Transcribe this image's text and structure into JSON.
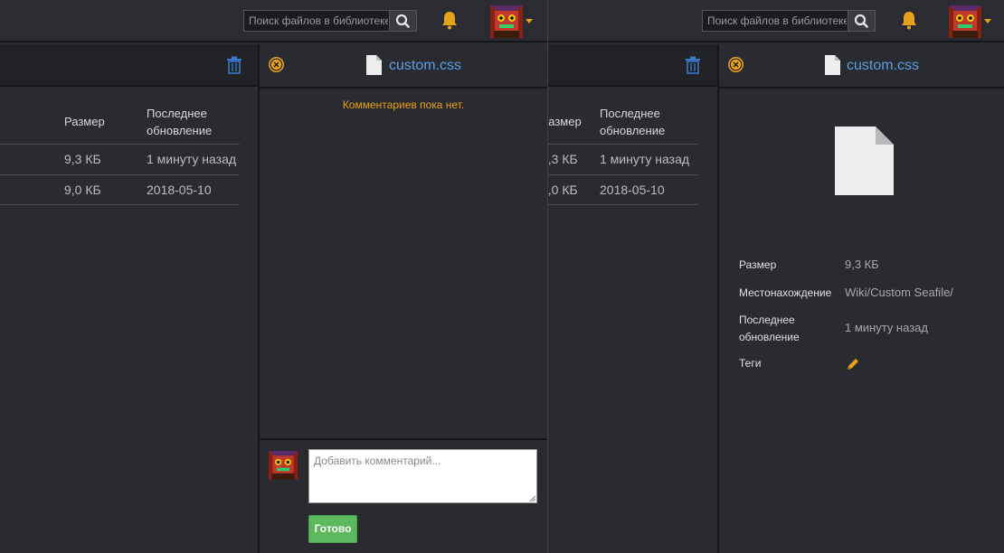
{
  "header": {
    "search_placeholder": "Поиск файлов в библиотеке"
  },
  "table": {
    "col_size": "Размер",
    "col_updated": "Последнее обновление",
    "rows": [
      {
        "size": "9,3 КБ",
        "updated": "1 минуту назад"
      },
      {
        "size": "9,0 КБ",
        "updated": "2018-05-10"
      }
    ]
  },
  "comments_panel": {
    "file_name": "custom.css",
    "empty_message": "Комментариев пока нет.",
    "input_placeholder": "Добавить комментарий...",
    "submit_label": "Готово"
  },
  "details_panel": {
    "file_name": "custom.css",
    "size_label": "Размер",
    "size_value": "9,3 КБ",
    "location_label": "Местонахождение",
    "location_value": "Wiki/Custom Seafile/",
    "updated_label": "Последнее обновление",
    "updated_value": "1 минуту назад",
    "tags_label": "Теги"
  },
  "icons": {
    "search": "search-icon",
    "notifications": "bell-icon",
    "user_menu": "caret-down-icon",
    "delete": "trash-icon",
    "close": "close-icon",
    "file": "file-icon",
    "edit": "pencil-icon"
  },
  "colors": {
    "accent": "#e8a21a",
    "link": "#5c9ee6",
    "success": "#5cb85c",
    "background": "#2a2b30"
  }
}
